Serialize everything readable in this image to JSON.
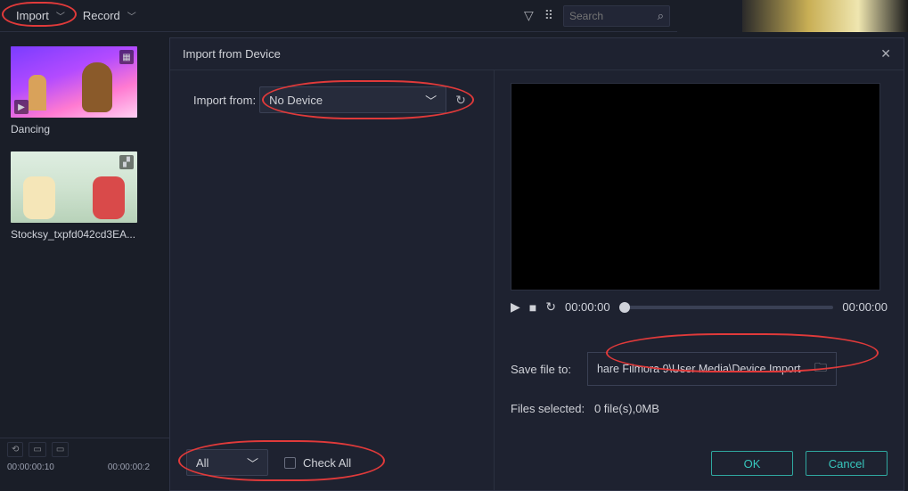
{
  "topbar": {
    "import_label": "Import",
    "record_label": "Record",
    "search_placeholder": "Search"
  },
  "media": {
    "items": [
      {
        "label": "Dancing"
      },
      {
        "label": "Stocksy_txpfd042cd3EA..."
      }
    ]
  },
  "dialog": {
    "title": "Import from Device",
    "import_from_label": "Import from:",
    "device_selected": "No Device",
    "filter_selected": "All",
    "check_all_label": "Check All",
    "time_start": "00:00:00",
    "time_end": "00:00:00",
    "save_label": "Save file to:",
    "save_path": "hare Filmora 9\\User Media\\Device Import",
    "files_selected_label": "Files selected:",
    "files_selected_value": "0 file(s),0MB",
    "ok_label": "OK",
    "cancel_label": "Cancel"
  },
  "timeline": {
    "t1": "00:00:00:10",
    "t2": "00:00:00:2"
  }
}
